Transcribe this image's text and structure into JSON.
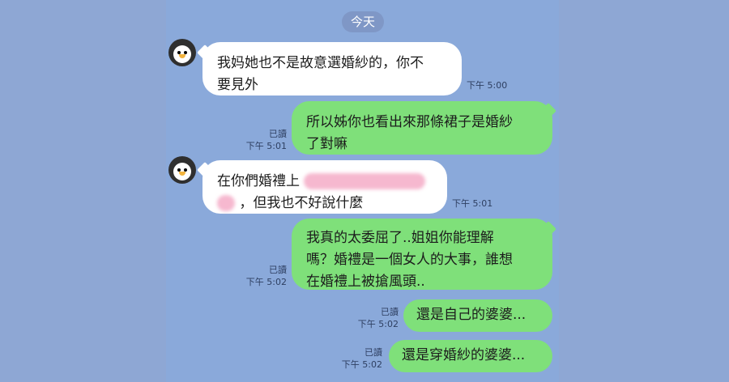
{
  "date_divider": "今天",
  "messages": [
    {
      "text_line1": "我妈她也不是故意選婚紗的，你不",
      "text_line2": "要見外",
      "time": "下午 5:00"
    },
    {
      "text_line1": "所以姊你也看出來那條裙子是婚紗",
      "text_line2": "了對嘛",
      "read": "已讀",
      "time": "下午 5:01"
    },
    {
      "text_line1": "在你們婚禮上",
      "text_line2": "，但我也不好說什麼",
      "time": "下午 5:01"
    },
    {
      "text_line1": "我真的太委屈了..姐姐你能理解",
      "text_line2": "嗎？婚禮是一個女人的大事，誰想",
      "text_line3": "在婚禮上被搶風頭..",
      "read": "已讀",
      "time": "下午 5:02"
    },
    {
      "text_line1": "還是自己的婆婆...",
      "read": "已讀",
      "time": "下午 5:02"
    },
    {
      "text_line1": "還是穿婚紗的婆婆...",
      "read": "已讀",
      "time": "下午 5:02"
    }
  ]
}
